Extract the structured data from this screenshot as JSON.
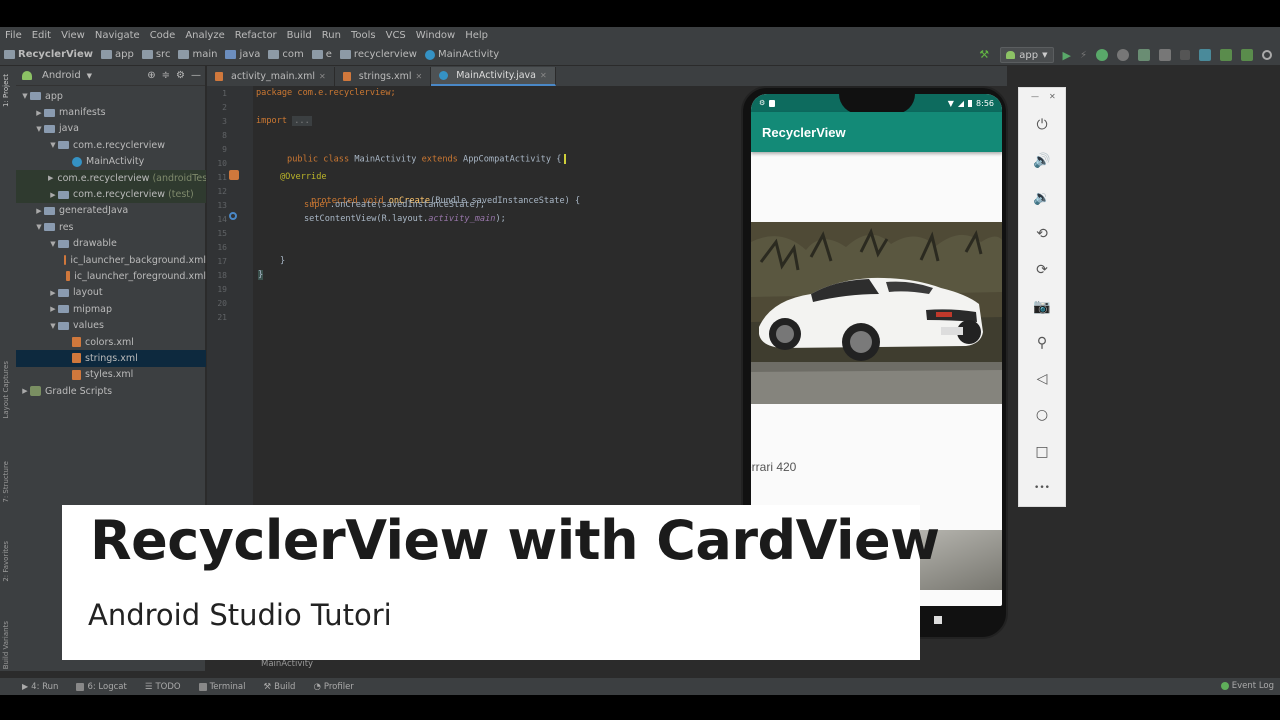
{
  "menu": [
    "File",
    "Edit",
    "View",
    "Navigate",
    "Code",
    "Analyze",
    "Refactor",
    "Build",
    "Run",
    "Tools",
    "VCS",
    "Window",
    "Help"
  ],
  "breadcrumbs": [
    "RecyclerView",
    "app",
    "src",
    "main",
    "java",
    "com",
    "e",
    "recyclerview",
    "MainActivity"
  ],
  "run_config": "app",
  "project_panel": {
    "view_mode": "Android",
    "tree": [
      {
        "label": "app",
        "indent": 0,
        "expanded": true,
        "icon": "folder"
      },
      {
        "label": "manifests",
        "indent": 1,
        "expanded": false,
        "icon": "folder"
      },
      {
        "label": "java",
        "indent": 1,
        "expanded": true,
        "icon": "folder"
      },
      {
        "label": "com.e.recyclerview",
        "indent": 2,
        "expanded": true,
        "icon": "package"
      },
      {
        "label": "MainActivity",
        "indent": 3,
        "icon": "class"
      },
      {
        "label": "com.e.recyclerview",
        "suffix": "(androidTest)",
        "indent": 2,
        "expanded": false,
        "icon": "package"
      },
      {
        "label": "com.e.recyclerview",
        "suffix": "(test)",
        "indent": 2,
        "expanded": false,
        "icon": "package"
      },
      {
        "label": "generatedJava",
        "indent": 1,
        "expanded": false,
        "icon": "folder"
      },
      {
        "label": "res",
        "indent": 1,
        "expanded": true,
        "icon": "folder"
      },
      {
        "label": "drawable",
        "indent": 2,
        "expanded": true,
        "icon": "folder"
      },
      {
        "label": "ic_launcher_background.xml",
        "indent": 3,
        "icon": "xml"
      },
      {
        "label": "ic_launcher_foreground.xml",
        "indent": 3,
        "icon": "xml"
      },
      {
        "label": "layout",
        "indent": 2,
        "expanded": false,
        "icon": "folder"
      },
      {
        "label": "mipmap",
        "indent": 2,
        "expanded": false,
        "icon": "folder"
      },
      {
        "label": "values",
        "indent": 2,
        "expanded": true,
        "icon": "folder"
      },
      {
        "label": "colors.xml",
        "indent": 3,
        "icon": "xml"
      },
      {
        "label": "strings.xml",
        "indent": 3,
        "icon": "xml",
        "selected": true
      },
      {
        "label": "styles.xml",
        "indent": 3,
        "icon": "xml"
      },
      {
        "label": "Gradle Scripts",
        "indent": 0,
        "expanded": false,
        "icon": "gradle"
      }
    ]
  },
  "left_stripe_tabs": [
    "1: Project",
    "Layout Captures",
    "7: Structure",
    "2: Favorites",
    "Build Variants"
  ],
  "editor_tabs": [
    {
      "label": "activity_main.xml",
      "active": false
    },
    {
      "label": "strings.xml",
      "active": false
    },
    {
      "label": "MainActivity.java",
      "active": true
    }
  ],
  "line_numbers": [
    "1",
    "2",
    "3",
    "8",
    "9",
    "10",
    "11",
    "12",
    "13",
    "14",
    "15",
    "16",
    "17",
    "18",
    "19",
    "20",
    "21"
  ],
  "code": {
    "package_line": "package com.e.recyclerview;",
    "import_kw": "import",
    "import_fold": "...",
    "class_decl": [
      "public",
      "class",
      "MainActivity",
      "extends",
      "AppCompatActivity",
      "{"
    ],
    "override": "@Override",
    "oncreate": [
      "protected",
      "void",
      "onCreate",
      "(Bundle savedInstanceState) {"
    ],
    "super_call": [
      "super",
      ".onCreate(savedInstanceState);"
    ],
    "set_content": [
      "setContentView(R.layout.",
      "activity_main",
      ");"
    ],
    "close_method": "}",
    "close_class": "}"
  },
  "editor_breadcrumb": "MainActivity",
  "bottom_tools": [
    "4: Run",
    "6: Logcat",
    "TODO",
    "Terminal",
    "Build",
    "Profiler"
  ],
  "event_log": "Event Log",
  "phone": {
    "app_title": "RecyclerView",
    "status_time": "8:56",
    "card_label": "errari 420"
  },
  "emulator_controls": [
    "power-icon",
    "volume-up-icon",
    "volume-down-icon",
    "rotate-left-icon",
    "rotate-right-icon",
    "camera-icon",
    "zoom-icon",
    "back-icon",
    "home-icon",
    "overview-icon",
    "more-icon"
  ],
  "overlay": {
    "title": "RecyclerView with CardView",
    "subtitle": "Android Studio Tutori"
  },
  "colors": {
    "ide_bg": "#2b2b2b",
    "ide_panel": "#3c3f41",
    "app_primary": "#138a77",
    "app_dark": "#0d6b5e"
  }
}
